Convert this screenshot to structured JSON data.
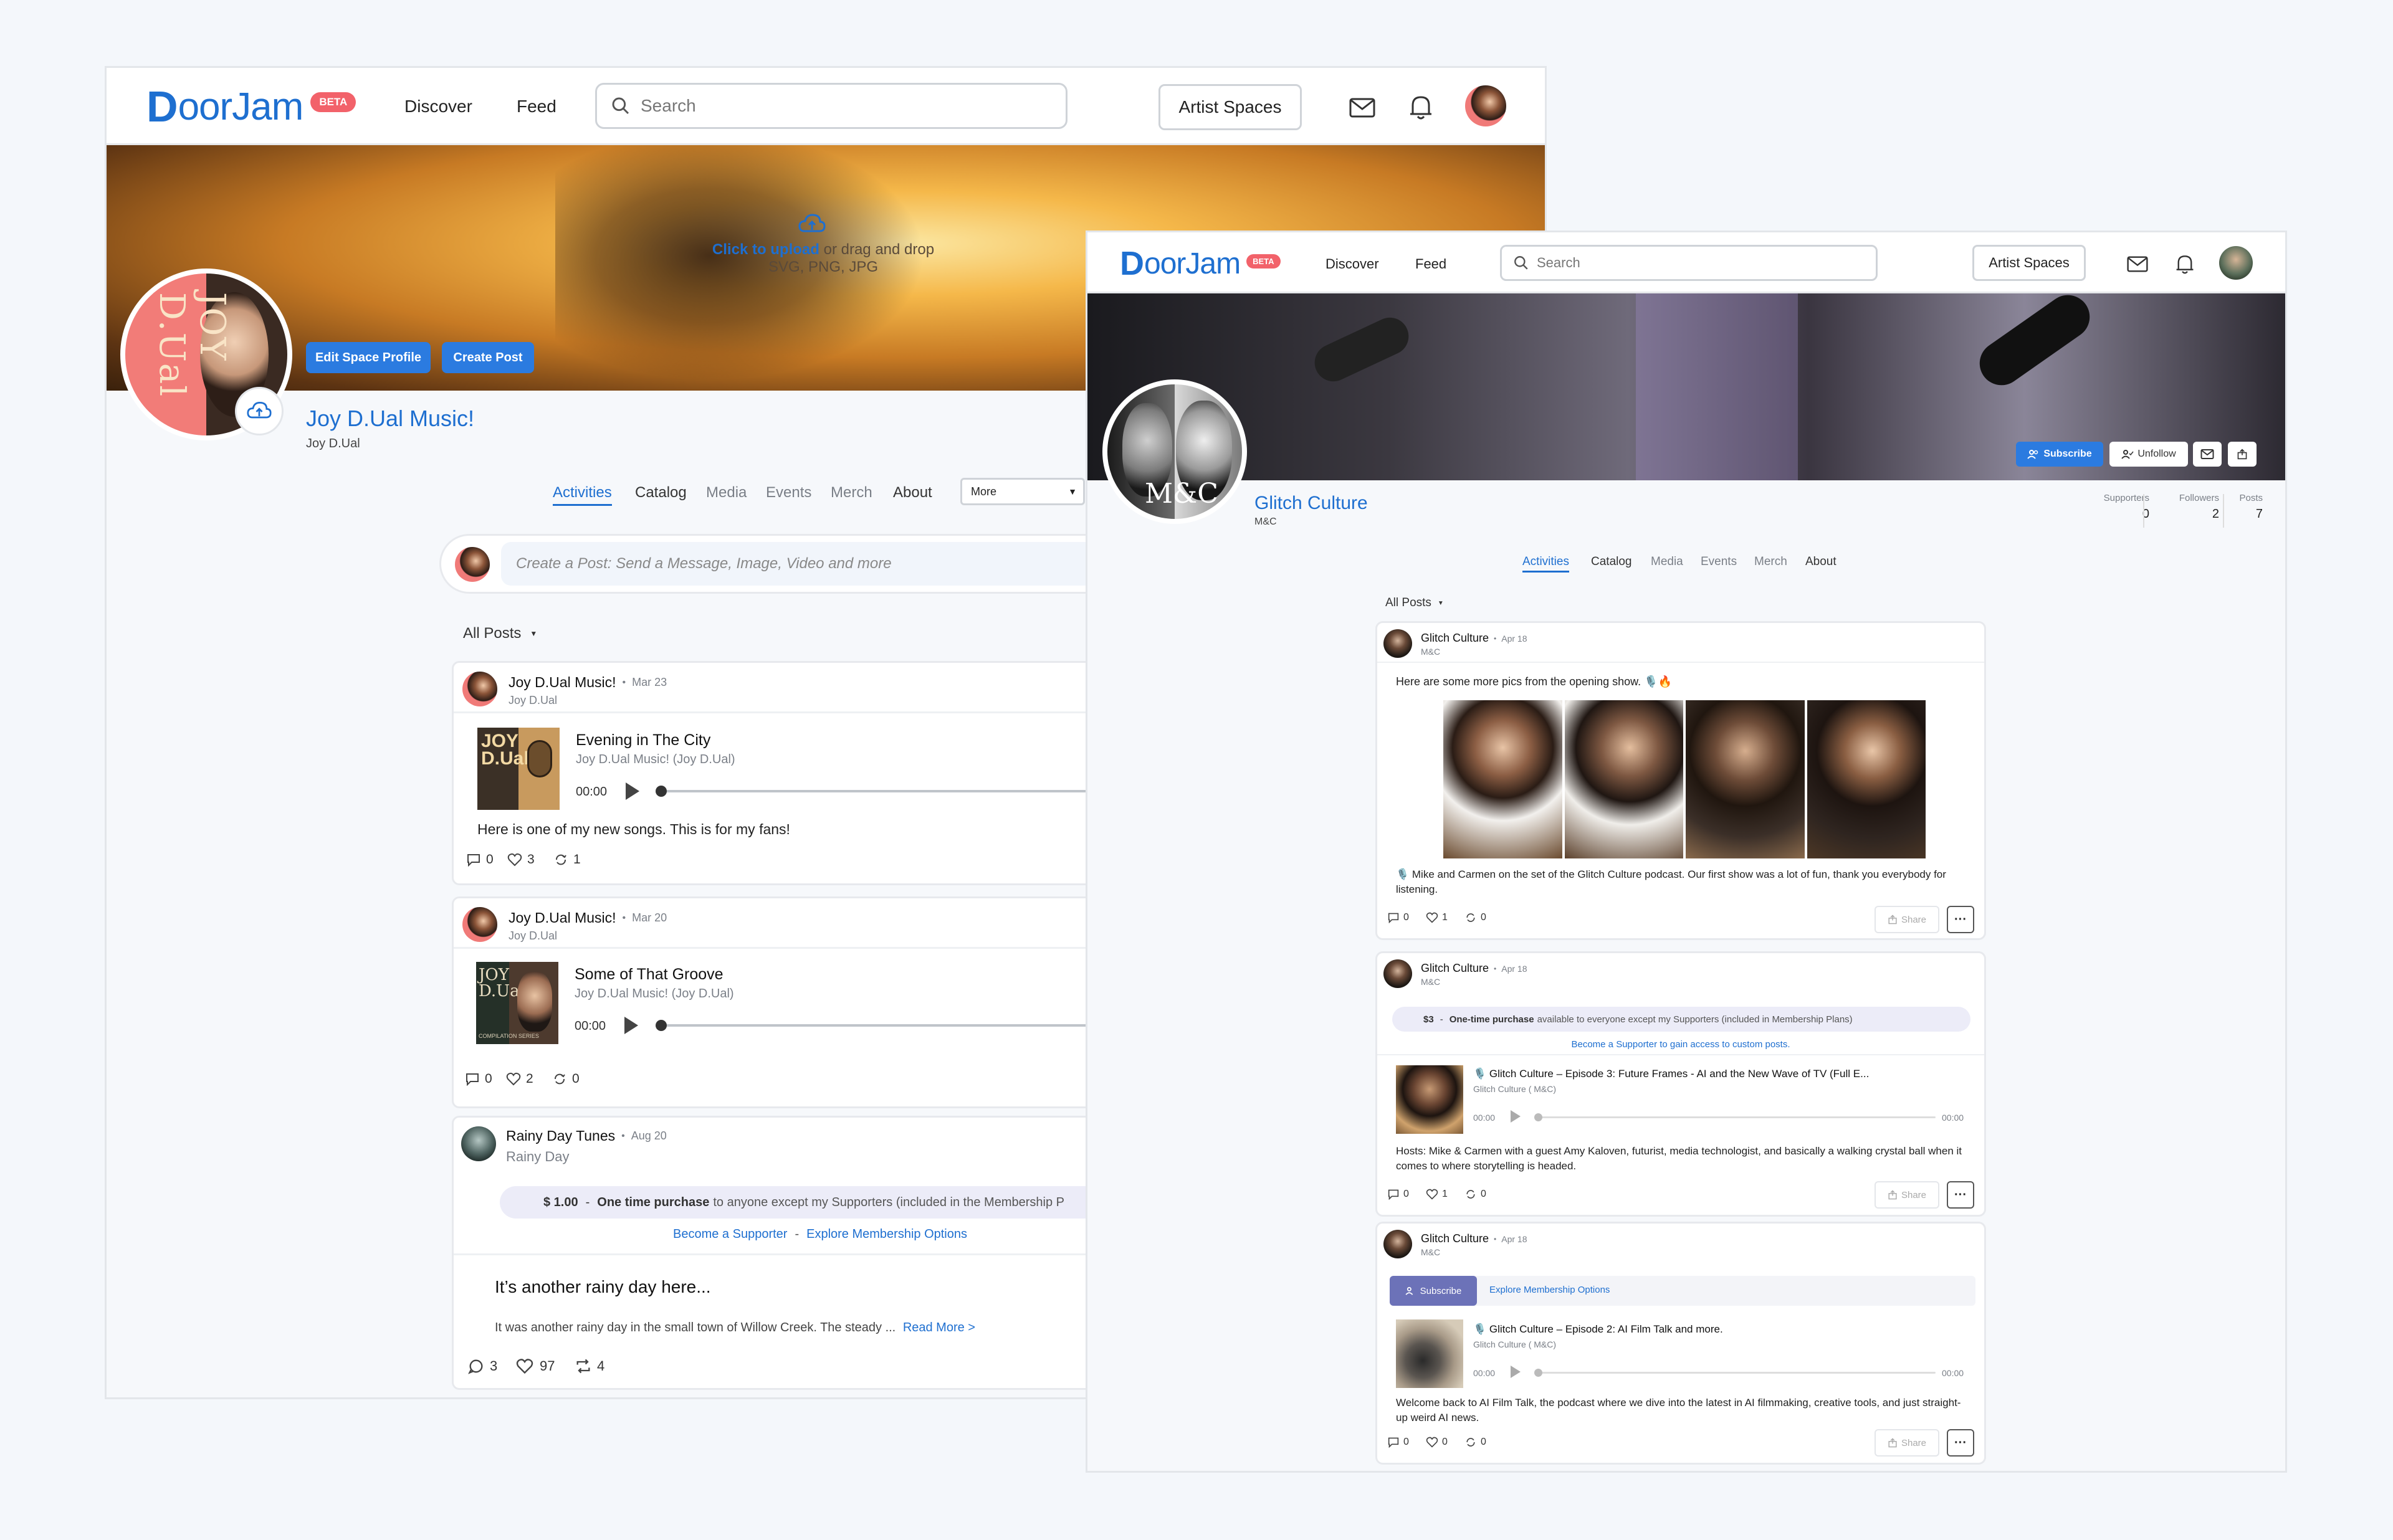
{
  "w1": {
    "logo": {
      "d": "D",
      "rest": "oorJam",
      "beta": "BETA"
    },
    "nav": {
      "discover": "Discover",
      "feed": "Feed",
      "search_placeholder": "Search",
      "artist_spaces": "Artist Spaces"
    },
    "banner": {
      "upload_link": "Click to upload",
      "upload_rest": " or drag and drop",
      "formats": "SVG, PNG, JPG",
      "edit_btn": "Edit Space Profile",
      "create_btn": "Create Post"
    },
    "profile": {
      "name": "Joy D.Ual Music!",
      "handle": "Joy D.Ual",
      "avatar_text": "JOY D.Ual"
    },
    "tabs": [
      "Activities",
      "Catalog",
      "Media",
      "Events",
      "Merch",
      "About"
    ],
    "more": "More",
    "composer_placeholder": "Create a Post: Send a Message, Image, Video and more",
    "filter": "All Posts",
    "posts": [
      {
        "author": "Joy D.Ual Music!",
        "date": "Mar 23",
        "handle": "Joy D.Ual",
        "track": "Evening in The City",
        "artist": "Joy D.Ual Music! (Joy D.Ual)",
        "time": "00:00",
        "text": "Here is one of my new songs. This is for my fans!",
        "comments": "0",
        "likes": "3",
        "reposts": "1",
        "art_text": "JOY D.Ual"
      },
      {
        "author": "Joy D.Ual Music!",
        "date": "Mar 20",
        "handle": "Joy D.Ual",
        "track": "Some of That Groove",
        "artist": "Joy D.Ual Music! (Joy D.Ual)",
        "time": "00:00",
        "comments": "0",
        "likes": "2",
        "reposts": "0",
        "art_text": "JOY D.Ual",
        "art_caption": "COMPILATION SERIES"
      },
      {
        "author": "Rainy Day Tunes",
        "date": "Aug 20",
        "handle": "Rainy Day",
        "price": "$ 1.00",
        "price_sep": "-",
        "price_strong": "One time purchase",
        "price_rest": "to anyone except my Supporters (included in the Membership P",
        "link1": "Become a Supporter",
        "link_sep": "-",
        "link2": "Explore Membership Options",
        "title": "It’s another rainy day here...",
        "excerpt": "It was another rainy day in the small town of Willow Creek. The steady ...",
        "read_more": "Read More >",
        "comments": "3",
        "likes": "97",
        "reposts": "4"
      }
    ]
  },
  "w2": {
    "logo": {
      "d": "D",
      "rest": "oorJam",
      "beta": "BETA"
    },
    "nav": {
      "discover": "Discover",
      "feed": "Feed",
      "search_placeholder": "Search",
      "artist_spaces": "Artist Spaces"
    },
    "banner": {
      "subscribe": "Subscribe",
      "unfollow": "Unfollow"
    },
    "profile": {
      "name": "Glitch Culture",
      "handle": "M&C",
      "avatar_text": "M&C"
    },
    "stats": [
      {
        "label": "Supporters",
        "value": "0"
      },
      {
        "label": "Followers",
        "value": "2"
      },
      {
        "label": "Posts",
        "value": "7"
      }
    ],
    "tabs": [
      "Activities",
      "Catalog",
      "Media",
      "Events",
      "Merch",
      "About"
    ],
    "filter": "All Posts",
    "posts": [
      {
        "author": "Glitch Culture",
        "date": "Apr 18",
        "handle": "M&C",
        "text": "Here are some more pics from the opening show. 🎙️🔥",
        "caption": "🎙️ Mike and Carmen on the set of the Glitch Culture podcast. Our first show was a lot of fun, thank you everybody for listening.",
        "comments": "0",
        "likes": "1",
        "reposts": "0",
        "share": "Share"
      },
      {
        "author": "Glitch Culture",
        "date": "Apr 18",
        "handle": "M&C",
        "price": "$3",
        "price_sep": "-",
        "price_strong": "One-time purchase",
        "price_rest": "available to everyone except my Supporters (included in Membership Plans)",
        "link": "Become a Supporter to gain access to custom posts.",
        "track": "🎙️ Glitch Culture – Episode 3: Future Frames - AI and the New Wave of TV (Full E...",
        "artist": "Glitch Culture ( M&C)",
        "time_start": "00:00",
        "time_end": "00:00",
        "text": "Hosts: Mike & Carmen with a guest Amy Kaloven, futurist, media technologist, and basically a walking crystal ball when it comes to where storytelling is headed.",
        "comments": "0",
        "likes": "1",
        "reposts": "0",
        "share": "Share"
      },
      {
        "author": "Glitch Culture",
        "date": "Apr 18",
        "handle": "M&C",
        "subscribe": "Subscribe",
        "explore": "Explore Membership Options",
        "track": "🎙️ Glitch Culture – Episode 2: AI Film Talk and more.",
        "artist": "Glitch Culture ( M&C)",
        "time_start": "00:00",
        "time_end": "00:00",
        "text": "Welcome back to AI Film Talk, the podcast where we dive into the latest in AI filmmaking, creative tools, and just straight-up weird AI news.",
        "comments": "0",
        "likes": "0",
        "reposts": "0",
        "share": "Share"
      }
    ]
  }
}
